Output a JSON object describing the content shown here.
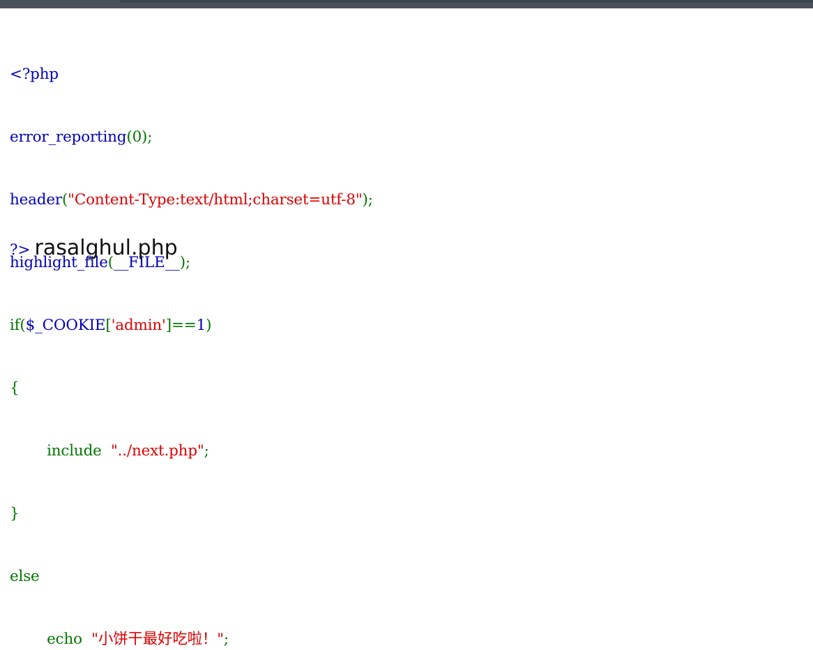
{
  "source": {
    "line1": "<?php",
    "line2_func": "error_reporting",
    "line2_args": "(0);",
    "line3_func": "header",
    "line3_open": "(",
    "line3_str": "\"Content-Type:text/html;charset=utf-8\"",
    "line3_close": ");",
    "line4_func": "highlight_file",
    "line4_open": "(",
    "line4_const": "__FILE__",
    "line4_close": ");",
    "line5_kw": "if(",
    "line5_var": "$_COOKIE",
    "line5_brk": "[",
    "line5_key": "'admin'",
    "line5_cmp": "]==",
    "line5_num": "1",
    "line5_end": ")",
    "line6": "{",
    "line7_kw": "include",
    "line7_str": "\"../next.php\"",
    "line7_end": ";",
    "line8": "}",
    "line9": "else",
    "line10_kw": "echo",
    "line10_str": "\"小饼干最好吃啦！\"",
    "line10_end": ";",
    "end_tag": "?>"
  },
  "output_text": "rasalghul.php",
  "colors": {
    "html": "#000000",
    "default": "#0000bb",
    "keyword": "#007700",
    "string": "#dd0000",
    "titlebar": "#4a5058"
  }
}
